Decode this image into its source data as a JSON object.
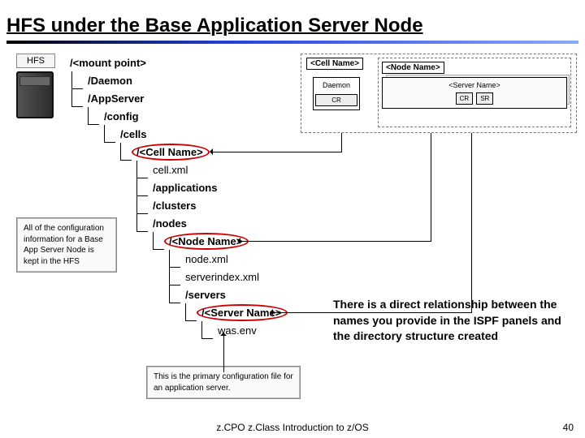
{
  "title": "HFS under the Base Application Server Node",
  "footer": "z.CPO z.Class Introduction to z/OS",
  "page_num": "40",
  "hfs_label": "HFS",
  "tree": {
    "mount": "/<mount point>",
    "daemon": "/Daemon",
    "appserver": "/AppServer",
    "config": "/config",
    "cells": "/cells",
    "cell_name": "/<Cell Name>",
    "cell_xml": "cell.xml",
    "applications": "/applications",
    "clusters": "/clusters",
    "nodes": "/nodes",
    "node_name": "/<Node Name>",
    "node_xml": "node.xml",
    "serverindex": "serverindex.xml",
    "servers": "/servers",
    "server_name": "/<Server Name>",
    "was_env": "was.env"
  },
  "right": {
    "cell": "<Cell Name>",
    "node": "<Node Name>",
    "daemon": "Daemon",
    "cr": "CR",
    "server": "<Server Name>",
    "sr": "SR"
  },
  "notes": {
    "hfs_info": "All of the configuration information for a Base App Server Node is kept in the HFS",
    "primary_cfg": "This is the primary configuration file for an application server.",
    "main": "There is a direct relationship between the names you provide in the ISPF panels and the directory structure created"
  }
}
